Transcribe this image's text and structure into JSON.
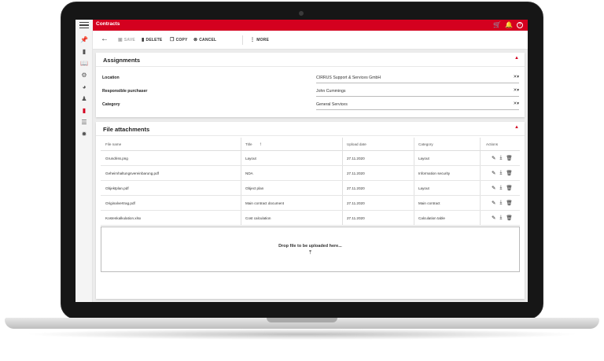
{
  "app": {
    "title": "Contracts"
  },
  "topbar_icons": [
    {
      "name": "cart-icon",
      "glyph": "🛒"
    },
    {
      "name": "bell-icon",
      "glyph": "🔔"
    },
    {
      "name": "help-icon",
      "glyph": "?"
    }
  ],
  "sidebar_icons": [
    "pin-icon",
    "contract-document-icon",
    "book-icon",
    "network-icon",
    "pie-chart-icon",
    "person-icon",
    "red-document-icon",
    "database-icon",
    "gear-icon"
  ],
  "toolbar": {
    "save": "SAVE",
    "delete": "DELETE",
    "copy": "COPY",
    "cancel": "CANCEL",
    "more": "MORE"
  },
  "assignments": {
    "title": "Assignments",
    "fields": [
      {
        "label": "Location",
        "value": "CIRRUS Support & Services GmbH"
      },
      {
        "label": "Responsible purchaser",
        "value": "John Cummings"
      },
      {
        "label": "Category",
        "value": "General Services"
      }
    ]
  },
  "attachments": {
    "title": "File attachments",
    "columns": [
      "File name",
      "Title",
      "Upload date",
      "Category",
      "Actions"
    ],
    "rows": [
      {
        "file": "Grundriss.png",
        "title": "Layout",
        "date": "27.11.2020",
        "category": "Layout"
      },
      {
        "file": "Geheimhaltungsvereinbarung.pdf",
        "title": "NDA",
        "date": "27.11.2020",
        "category": "Information security"
      },
      {
        "file": "Objektplan.pdf",
        "title": "Object plan",
        "date": "27.11.2020",
        "category": "Layout"
      },
      {
        "file": "Originalvertrag.pdf",
        "title": "Main contract document",
        "date": "27.11.2020",
        "category": "Main contract"
      },
      {
        "file": "Kostenkalkulation.xlsx",
        "title": "Cost calculation",
        "date": "27.11.2020",
        "category": "Calculation table"
      }
    ],
    "dropzone_text": "Drop file to be uploaded here..."
  },
  "colors": {
    "accent": "#d4001f",
    "background": "#ececec"
  }
}
